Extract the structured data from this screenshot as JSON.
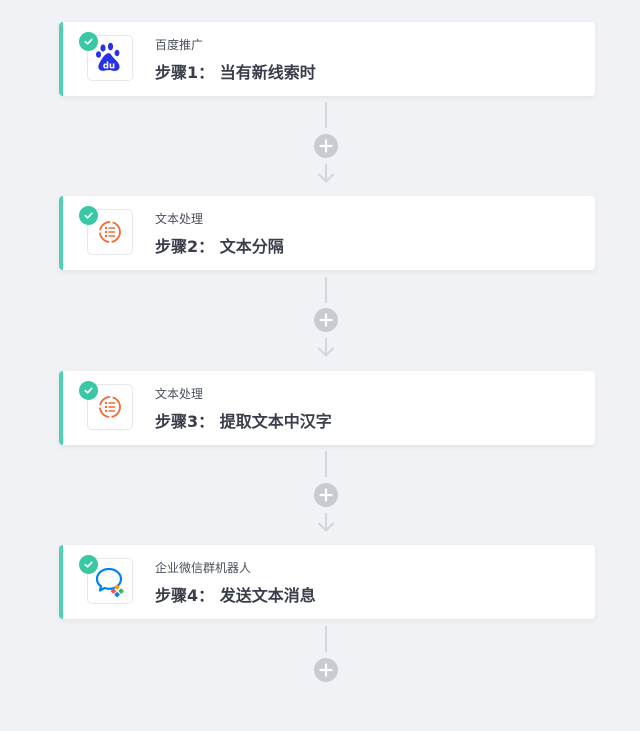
{
  "colors": {
    "accent": "#4fd1b2",
    "check": "#39c8a3",
    "baidu_blue": "#2932e1",
    "text_process_orange": "#f06a35",
    "wecom_blue": "#0082ef",
    "connector_gray": "#c9cbd1"
  },
  "steps": [
    {
      "app_name": "百度推广",
      "title": "步骤1： 当有新线索时",
      "icon": "baidu-paw-icon",
      "status_icon": "check-icon"
    },
    {
      "app_name": "文本处理",
      "title": "步骤2： 文本分隔",
      "icon": "text-process-icon",
      "status_icon": "check-icon"
    },
    {
      "app_name": "文本处理",
      "title": "步骤3： 提取文本中汉字",
      "icon": "text-process-icon",
      "status_icon": "check-icon"
    },
    {
      "app_name": "企业微信群机器人",
      "title": "步骤4： 发送文本消息",
      "icon": "wecom-robot-icon",
      "status_icon": "check-icon"
    }
  ],
  "connectors": [
    {
      "icon": "plus-icon"
    },
    {
      "icon": "plus-icon"
    },
    {
      "icon": "plus-icon"
    },
    {
      "icon": "plus-icon"
    }
  ]
}
